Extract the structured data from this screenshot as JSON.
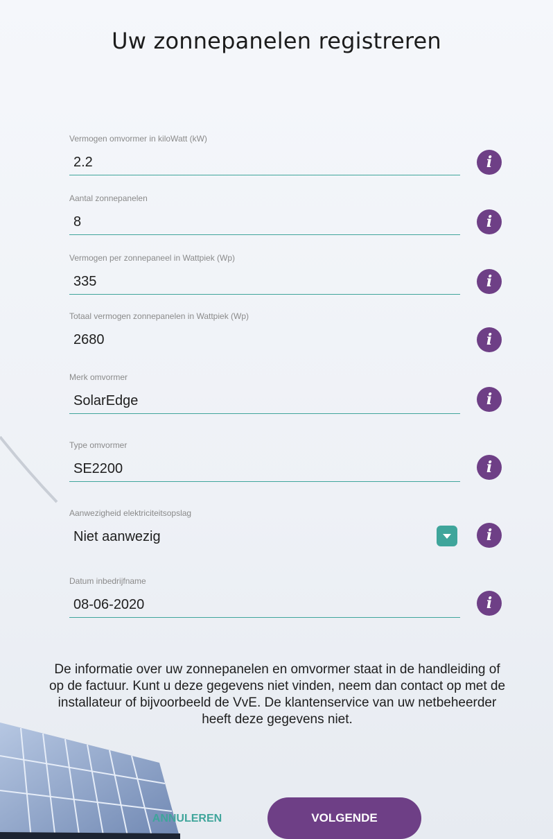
{
  "title": "Uw zonnepanelen registreren",
  "fields": [
    {
      "label": "Vermogen omvormer in kiloWatt (kW)",
      "value": "2.2"
    },
    {
      "label": "Aantal zonnepanelen",
      "value": "8"
    },
    {
      "label": "Vermogen per zonnepaneel in Wattpiek (Wp)",
      "value": "335"
    },
    {
      "label": "Totaal vermogen zonnepanelen in Wattpiek (Wp)",
      "value": "2680"
    },
    {
      "label": "Merk omvormer",
      "value": "SolarEdge"
    },
    {
      "label": "Type omvormer",
      "value": "SE2200"
    },
    {
      "label": "Aanwezigheid elektriciteitsopslag",
      "value": "Niet aanwezig"
    },
    {
      "label": "Datum inbedrijfname",
      "value": "08-06-2020"
    }
  ],
  "info_icon": "info-icon",
  "dropdown_icon": "chevron-down-icon",
  "info_text": "De informatie over uw zonnepanelen en omvormer staat in de handleiding of op de factuur. Kunt u deze gegevens niet vinden, neem dan contact op met de installateur of bijvoorbeeld de VvE. De klantenservice van uw netbeheerder heeft deze gegevens niet.",
  "buttons": {
    "cancel": "ANNULEREN",
    "next": "VOLGENDE"
  },
  "colors": {
    "accent": "#3fa59b",
    "brand": "#6e3f86"
  }
}
